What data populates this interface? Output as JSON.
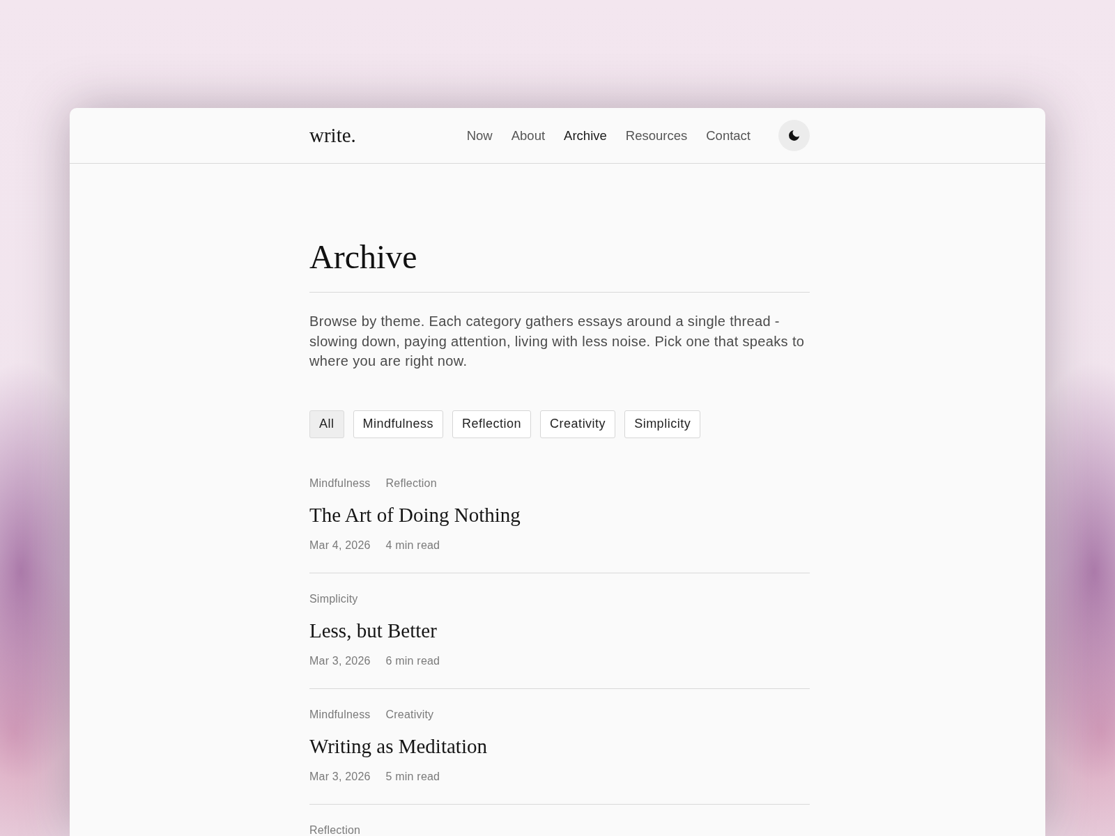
{
  "site": {
    "logo": "write."
  },
  "nav": [
    {
      "label": "Now",
      "selected": false
    },
    {
      "label": "About",
      "selected": false
    },
    {
      "label": "Archive",
      "selected": true
    },
    {
      "label": "Resources",
      "selected": false
    },
    {
      "label": "Contact",
      "selected": false
    }
  ],
  "page": {
    "title": "Archive",
    "intro": "Browse by theme. Each category gathers essays around a single thread - slowing down, paying attention, living with less noise. Pick one that speaks to where you are right now."
  },
  "filters": [
    {
      "label": "All",
      "selected": true
    },
    {
      "label": "Mindfulness",
      "selected": false
    },
    {
      "label": "Reflection",
      "selected": false
    },
    {
      "label": "Creativity",
      "selected": false
    },
    {
      "label": "Simplicity",
      "selected": false
    }
  ],
  "posts": [
    {
      "tags": [
        "Mindfulness",
        "Reflection"
      ],
      "title": "The Art of Doing Nothing",
      "date": "Mar 4, 2026",
      "read_time": "4 min read"
    },
    {
      "tags": [
        "Simplicity"
      ],
      "title": "Less, but Better",
      "date": "Mar 3, 2026",
      "read_time": "6 min read"
    },
    {
      "tags": [
        "Mindfulness",
        "Creativity"
      ],
      "title": "Writing as Meditation",
      "date": "Mar 3, 2026",
      "read_time": "5 min read"
    },
    {
      "tags": [
        "Reflection"
      ]
    }
  ]
}
